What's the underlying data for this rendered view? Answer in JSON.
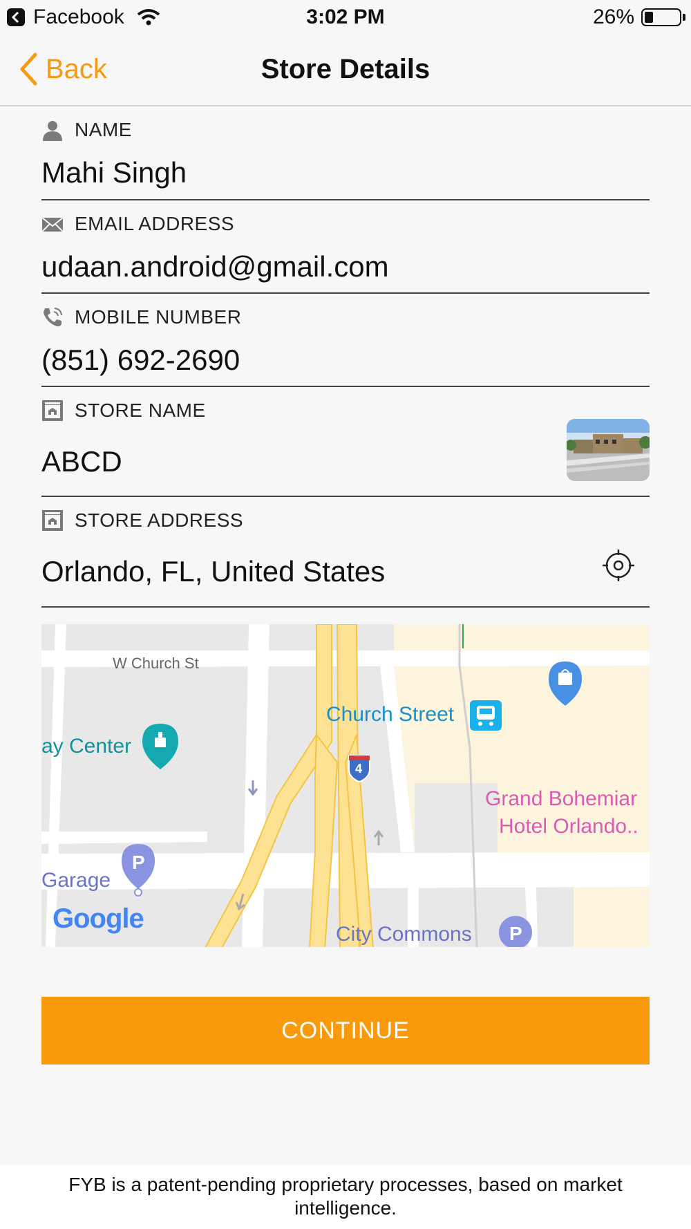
{
  "status_bar": {
    "app_name": "Facebook",
    "time": "3:02 PM",
    "battery_percent": "26%",
    "battery_level": 0.26
  },
  "nav": {
    "back_label": "Back",
    "title": "Store Details"
  },
  "form": {
    "name": {
      "label": "NAME",
      "value": "Mahi Singh",
      "icon": "person-icon"
    },
    "email": {
      "label": "EMAIL ADDRESS",
      "value": "udaan.android@gmail.com",
      "icon": "envelope-icon"
    },
    "mobile": {
      "label": "MOBILE NUMBER",
      "value": "(851) 692-2690",
      "icon": "phone-icon"
    },
    "store_name": {
      "label": "STORE NAME",
      "value": "ABCD",
      "icon": "store-icon"
    },
    "store_address": {
      "label": "STORE ADDRESS",
      "value": "Orlando, FL, United States",
      "icon": "store-icon"
    }
  },
  "map": {
    "labels": {
      "w_church_st": "W Church St",
      "church_street": "Church Street",
      "day_center": "ay Center",
      "grand_bohemian_1": "Grand Bohemiar",
      "grand_bohemian_2": "Hotel Orlando..",
      "garage": "Garage",
      "city_commons": "City Commons",
      "interstate": "4",
      "google": "Google"
    },
    "colors": {
      "road": "#ffffff",
      "highway": "#fde293",
      "highway_edge": "#f4c542",
      "block": "#e8e8e8",
      "poi_area": "#fcf4dd",
      "transit": "#1ab0ea",
      "pink_label": "#d85bb4",
      "teal_pin": "#14a8b0",
      "parking": "#8a94e0"
    }
  },
  "continue_button": {
    "label": "CONTINUE",
    "color": "#f89a0c"
  },
  "footer": {
    "text": "FYB is a patent-pending proprietary processes, based on market intelligence."
  }
}
